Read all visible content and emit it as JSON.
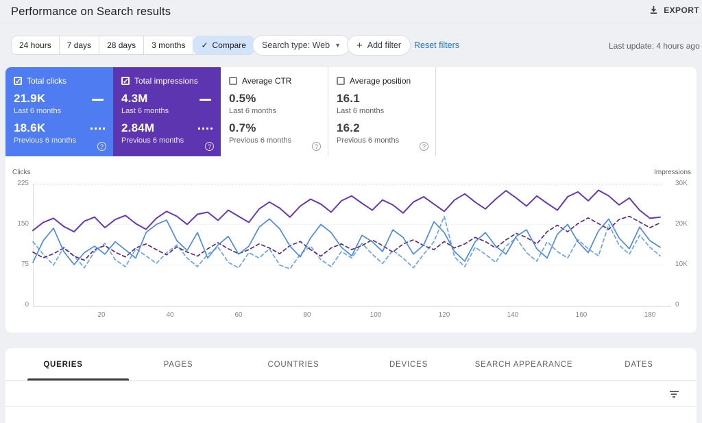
{
  "header": {
    "title": "Performance on Search results",
    "export_label": "EXPORT"
  },
  "filter_bar": {
    "date_chips": [
      {
        "label": "24 hours",
        "selected": false
      },
      {
        "label": "7 days",
        "selected": false
      },
      {
        "label": "28 days",
        "selected": false
      },
      {
        "label": "3 months",
        "selected": false
      },
      {
        "label": "Compare",
        "selected": true
      }
    ],
    "search_type_label": "Search type: Web",
    "add_filter_label": "Add filter",
    "reset_filters_label": "Reset filters",
    "last_update": "Last update: 4 hours ago"
  },
  "metric_cards": [
    {
      "label": "Total clicks",
      "checked": true,
      "bg": "#4f7cf1",
      "primary": {
        "value": "21.9K",
        "period": "Last 6 months"
      },
      "secondary": {
        "value": "18.6K",
        "period": "Previous 6 months"
      }
    },
    {
      "label": "Total impressions",
      "checked": true,
      "bg": "#5e35b1",
      "primary": {
        "value": "4.3M",
        "period": "Last 6 months"
      },
      "secondary": {
        "value": "2.84M",
        "period": "Previous 6 months"
      }
    },
    {
      "label": "Average CTR",
      "checked": false,
      "bg": "#ffffff",
      "primary": {
        "value": "0.5%",
        "period": "Last 6 months"
      },
      "secondary": {
        "value": "0.7%",
        "period": "Previous 6 months"
      }
    },
    {
      "label": "Average position",
      "checked": false,
      "bg": "#ffffff",
      "primary": {
        "value": "16.1",
        "period": "Last 6 months"
      },
      "secondary": {
        "value": "16.2",
        "period": "Previous 6 months"
      }
    }
  ],
  "chart_data": {
    "type": "line",
    "x_step": 3,
    "x_ticks": [
      20,
      40,
      60,
      80,
      100,
      120,
      140,
      160,
      180
    ],
    "left_axis": {
      "label": "Clicks",
      "ticks": [
        225,
        150,
        75,
        0
      ],
      "max": 225
    },
    "right_axis": {
      "label": "Impressions",
      "ticks": [
        "30K",
        "20K",
        "10K",
        "0"
      ],
      "max_k": 30
    },
    "legend_note": "solid = Last 6 months, dashed = Previous 6 months",
    "series": [
      {
        "name": "Total clicks - Last 6 months",
        "axis": "left",
        "color": "#4b8af3",
        "dashed": false,
        "values": [
          80,
          120,
          143,
          100,
          76,
          98,
          110,
          95,
          118,
          103,
          88,
          135,
          150,
          158,
          120,
          102,
          135,
          88,
          112,
          128,
          95,
          110,
          145,
          160,
          142,
          110,
          90,
          125,
          150,
          135,
          108,
          92,
          130,
          118,
          100,
          140,
          126,
          95,
          112,
          155,
          135,
          100,
          82,
          118,
          135,
          110,
          95,
          128,
          140,
          105,
          88,
          132,
          150,
          118,
          98,
          138,
          160,
          125,
          105,
          145,
          120,
          108
        ]
      },
      {
        "name": "Total clicks - Previous 6 months",
        "axis": "left",
        "color": "#6ba1f7",
        "dashed": true,
        "values": [
          118,
          95,
          75,
          108,
          92,
          70,
          100,
          115,
          85,
          72,
          105,
          92,
          78,
          98,
          112,
          88,
          72,
          95,
          108,
          80,
          70,
          98,
          88,
          105,
          75,
          68,
          95,
          110,
          85,
          72,
          100,
          88,
          115,
          95,
          78,
          102,
          88,
          70,
          95,
          118,
          165,
          90,
          72,
          108,
          95,
          80,
          110,
          125,
          98,
          82,
          118,
          100,
          88,
          122,
          105,
          92,
          150,
          112,
          95,
          130,
          108,
          92
        ]
      },
      {
        "name": "Total impressions - Last 6 months (K)",
        "axis": "right",
        "color": "#6637ba",
        "dashed": false,
        "values": [
          18.5,
          20.5,
          21.5,
          19.5,
          18.2,
          20.8,
          21.8,
          19.2,
          21.2,
          22.2,
          20.2,
          18.8,
          21.5,
          23.2,
          22,
          20,
          22.5,
          23,
          21,
          23.5,
          22,
          20.5,
          23.8,
          25.5,
          24,
          21.8,
          24.5,
          26.2,
          25,
          23,
          25.8,
          27,
          25.2,
          23.5,
          26,
          24.8,
          22.8,
          25.5,
          26.8,
          25,
          23.2,
          26,
          27.5,
          25.5,
          23.8,
          26.2,
          28.3,
          26.5,
          24.5,
          27,
          25.2,
          23.5,
          26.8,
          28,
          25.8,
          28.4,
          27,
          24.8,
          26.5,
          23.5,
          21.5,
          21.8
        ]
      },
      {
        "name": "Total impressions - Previous 6 months (K)",
        "axis": "right",
        "color": "#5d2b82",
        "dashed": true,
        "values": [
          13.2,
          11.8,
          12.8,
          14.2,
          12.2,
          11.2,
          13.8,
          14.8,
          13.2,
          12,
          14.2,
          15.2,
          13.8,
          12.5,
          14.5,
          13.2,
          12.2,
          14,
          15.5,
          14,
          12.8,
          13.8,
          15.2,
          14.2,
          12.8,
          14.8,
          15.8,
          13.8,
          12.2,
          14.2,
          15.2,
          13.8,
          14.8,
          16.2,
          14.8,
          13.2,
          15.2,
          16.2,
          14.8,
          13.8,
          15.8,
          14.2,
          15.2,
          16.8,
          15.8,
          14.2,
          16.2,
          17.8,
          16.8,
          15.2,
          18.2,
          19.8,
          18.2,
          20.2,
          21.6,
          20.2,
          18.8,
          21.2,
          22,
          20.6,
          19.2,
          20.4
        ]
      }
    ]
  },
  "tabs": [
    {
      "label": "QUERIES",
      "active": true
    },
    {
      "label": "PAGES",
      "active": false
    },
    {
      "label": "COUNTRIES",
      "active": false
    },
    {
      "label": "DEVICES",
      "active": false
    },
    {
      "label": "SEARCH APPEARANCE",
      "active": false
    },
    {
      "label": "DATES",
      "active": false
    }
  ]
}
